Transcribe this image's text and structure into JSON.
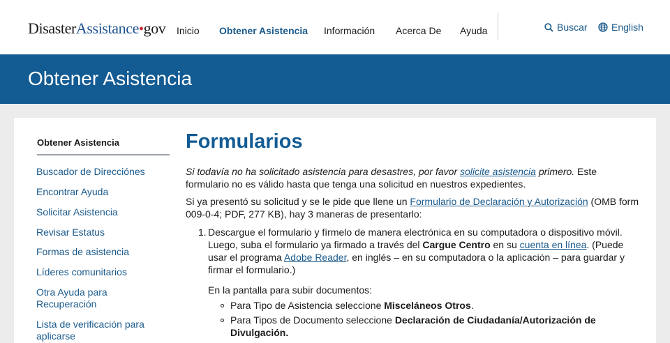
{
  "header": {
    "logo": {
      "part1": "Disaster",
      "part2": "Assistance",
      "dot": "•",
      "part3": "gov"
    },
    "nav": [
      {
        "label": "Inicio",
        "active": false
      },
      {
        "label": "Obtener Asistencia",
        "active": true
      },
      {
        "label": "Información",
        "active": false
      },
      {
        "label": "Acerca De",
        "active": false
      },
      {
        "label": "Ayuda",
        "active": false
      }
    ],
    "search_label": "Buscar",
    "language_label": "English"
  },
  "banner": {
    "title": "Obtener Asistencia"
  },
  "sidebar": {
    "heading": "Obtener Asistencia",
    "items": [
      "Buscador de Direcciónes",
      "Encontrar Ayuda",
      "Solicitar Asistencia",
      "Revisar Estatus",
      "Formas de asistencia",
      "Líderes comunitarios",
      "Otra Ayuda para Recuperación",
      "Lista de verificación para aplicarse"
    ]
  },
  "main": {
    "title": "Formularios",
    "intro": {
      "italic_before": "Si todavía no ha solicitado asistencia para desastres, por favor ",
      "link": "solicite asistencia",
      "italic_after": " primero.",
      "rest": " Este formulario no es válido hasta que tenga una solicitud en nuestros expedientes."
    },
    "para2": {
      "before": "Si ya presentó su solicitud y se le pide que llene un ",
      "link": "Formulario de Declaración y Autorización",
      "after": " (OMB form 009-0-4; PDF, 277 KB), hay 3 maneras de presentarlo:"
    },
    "step1": {
      "number": "1.",
      "t1": "Descargue el formulario y fírmelo de manera electrónica en su computadora o dispositivo móvil. Luego, suba el formulario ya firmado a través del ",
      "b1": "Cargue Centro",
      "t2": " en su ",
      "link1": "cuenta en línea",
      "t3": ". (Puede usar el programa ",
      "link2": "Adobe Reader",
      "t4": ", en inglés – en su computadora o la aplicación – para guardar y firmar el formulario.)"
    },
    "upload_intro": "En la pantalla para subir documentos:",
    "bullets": [
      {
        "text": "Para Tipo de Asistencia seleccione ",
        "bold": "Misceláneos Otros",
        "end": "."
      },
      {
        "text": "Para Tipos de Documento seleccione ",
        "bold": "Declaración de Ciudadanía/Autorización de Divulgación.",
        "end": ""
      }
    ]
  },
  "colors": {
    "brand_blue": "#135b93",
    "link_blue": "#1a5a8c",
    "logo_red": "#d0202e"
  }
}
